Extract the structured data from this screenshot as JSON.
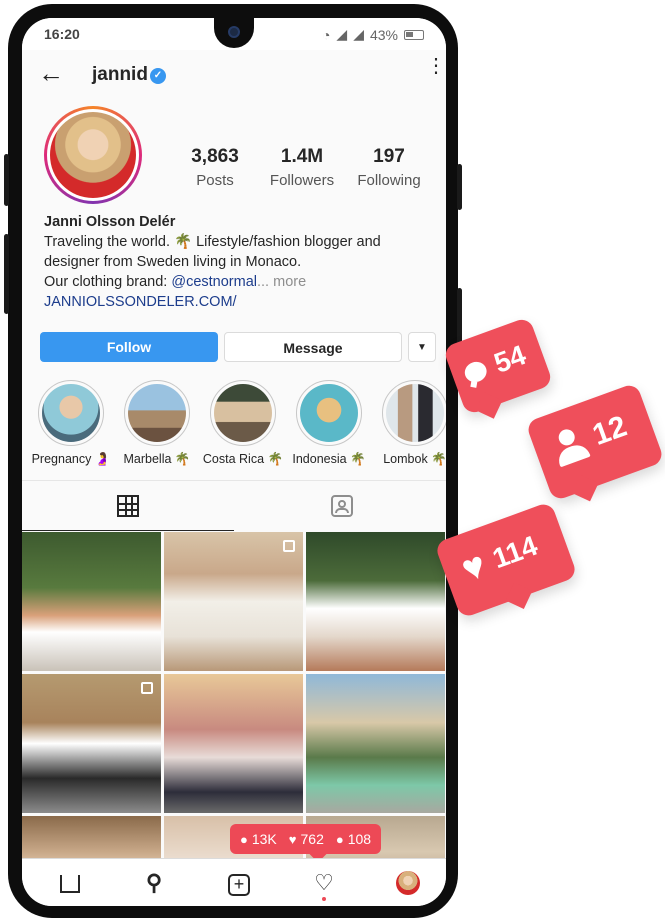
{
  "status_bar": {
    "time": "16:20",
    "battery": "43%"
  },
  "header": {
    "username": "jannid",
    "verified_icon": "✓"
  },
  "profile": {
    "stats": [
      {
        "value": "3,863",
        "label": "Posts"
      },
      {
        "value": "1.4M",
        "label": "Followers"
      },
      {
        "value": "197",
        "label": "Following"
      }
    ],
    "name": "Janni Olsson Delér",
    "bio_line1": "Traveling the world. 🌴 Lifestyle/fashion blogger and",
    "bio_line2": "designer from Sweden living in Monaco.",
    "bio_line3_prefix": "Our clothing brand: ",
    "bio_mention": "@cestnormal",
    "bio_more": "... more",
    "website": "JANNIOLSSONDELER.COM/"
  },
  "actions": {
    "follow": "Follow",
    "message": "Message",
    "dropdown": "▼"
  },
  "highlights": [
    {
      "label": "Pregnancy 🤰",
      "colors": [
        "#8fc9d8",
        "#e8c8a8",
        "#4a6b7c"
      ]
    },
    {
      "label": "Marbella 🌴",
      "colors": [
        "#9ac2e0",
        "#a88a6a",
        "#6b5240"
      ]
    },
    {
      "label": "Costa Rica 🌴",
      "colors": [
        "#d8c0a0",
        "#6b5a48",
        "#3d4a38"
      ]
    },
    {
      "label": "Indonesia 🌴",
      "colors": [
        "#5ab8c8",
        "#e8c080",
        "#ffffff"
      ]
    },
    {
      "label": "Lombok 🌴",
      "colors": [
        "#dfe6ea",
        "#b89a80",
        "#2a2a30"
      ]
    }
  ],
  "grid_posts": [
    {
      "bg": "linear-gradient(180deg,#3d5a2f 0%,#587a3e 40%,#d9a07a 60%,#ffffff 72%,#c9c2b8 100%)",
      "multi": false
    },
    {
      "bg": "linear-gradient(180deg,#d8c4a8 0%,#c9a88a 30%,#f2efe8 50%,#e8e2d8 75%,#b89878 100%)",
      "multi": true
    },
    {
      "bg": "linear-gradient(180deg,#2f4a2a 0%,#4c6b3a 35%,#ffffff 55%,#e4d8cc 75%,#b57a5a 100%)",
      "multi": false
    },
    {
      "bg": "linear-gradient(180deg,#b59a70 0%,#a8835c 35%,#ffffff 50%,#2a2a2a 75%,#8c8c8c 100%)",
      "multi": true
    },
    {
      "bg": "linear-gradient(180deg,#e8c898 0%,#c88a80 40%,#e8dcd8 60%,#2d2d3a 85%,#6a6a6a 100%)",
      "multi": false
    },
    {
      "bg": "linear-gradient(180deg,#8fb8d8 0%,#d8c8a8 35%,#5a7a4a 60%,#7dc8a8 80%,#a8a8a0 100%)",
      "multi": false
    },
    {
      "bg": "linear-gradient(180deg,#8a6a4a 0%,#c8a888 60%,#f0d8c0 100%)",
      "multi": false
    },
    {
      "bg": "linear-gradient(180deg,#d8c0a8 0%,#e8d8c8 60%,#f0e8e0 100%)",
      "multi": false
    },
    {
      "bg": "linear-gradient(180deg,#b8a890 0%,#d8c8b0 60%,#c0a890 100%)",
      "multi": false
    }
  ],
  "activity": {
    "comments": "13K",
    "likes": "762",
    "follows": "108"
  },
  "bubbles": {
    "comments": "54",
    "follows": "12",
    "likes": "114"
  },
  "colors": {
    "accent": "#3897f0",
    "notify": "#ed4956",
    "verified": "#3897f0"
  },
  "icons": {
    "back": "←",
    "menu": "⋮",
    "home": "home-icon",
    "search": "⚲",
    "add": "+",
    "heart": "♡",
    "heart_filled": "♥",
    "comment": "●",
    "user": "👤"
  }
}
